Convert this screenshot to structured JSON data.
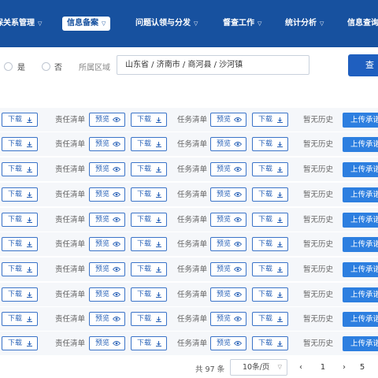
{
  "nav": {
    "items": [
      {
        "label": "保关系管理",
        "dropdown": true
      },
      {
        "label": "信息备案",
        "dropdown": true
      },
      {
        "label": "问题认领与分发",
        "dropdown": true
      },
      {
        "label": "督查工作",
        "dropdown": true
      },
      {
        "label": "统计分析",
        "dropdown": true
      },
      {
        "label": "信息查询",
        "dropdown": false
      }
    ],
    "active_index": 1
  },
  "filter": {
    "radio_yes": "是",
    "radio_no": "否",
    "region_label": "所属区域",
    "region_value": "山东省 / 济南市 / 商河县 / 沙河镇",
    "query_button": "查"
  },
  "table": {
    "download": "下载",
    "preview": "预览",
    "responsibility_list": "责任清单",
    "task_list": "任务清单",
    "no_history": "暂无历史",
    "upload": "上传承诺",
    "row_count": 10
  },
  "pagination": {
    "total": "共 97 条",
    "page_size": "10条/页",
    "prev": "‹",
    "current_page": "1",
    "next": "›",
    "last_page": "5"
  },
  "colors": {
    "nav_bg": "#17519f",
    "primary": "#1f5fbf",
    "upload_bg": "#2d7fe0",
    "outline": "#3a73c8"
  },
  "icons": {
    "download": "download-icon",
    "preview": "eye-icon",
    "dropdown": "chevron-down-icon"
  }
}
